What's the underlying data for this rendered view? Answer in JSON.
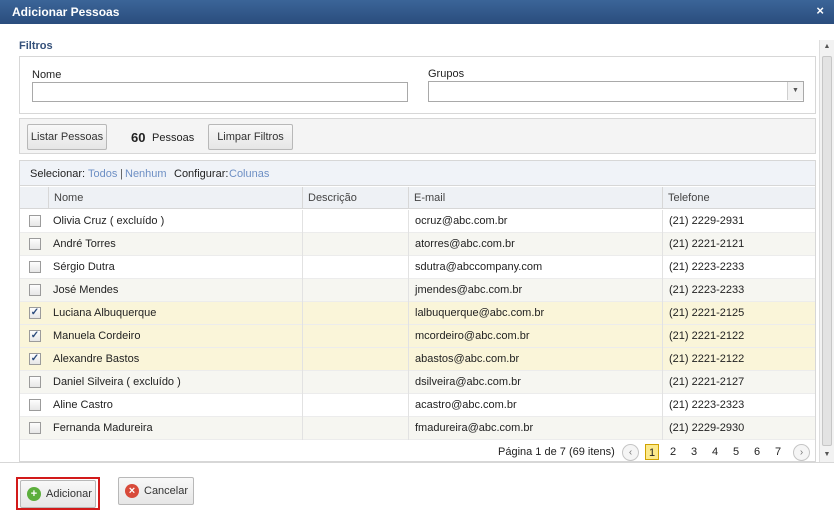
{
  "dialog": {
    "title": "Adicionar Pessoas",
    "close_icon": "×"
  },
  "filters": {
    "section_label": "Filtros",
    "name_label": "Nome",
    "name_value": "",
    "groups_label": "Grupos",
    "groups_value": ""
  },
  "toolbar": {
    "list_button": "Listar Pessoas",
    "count": "60",
    "count_label": "Pessoas",
    "clear_button": "Limpar Filtros"
  },
  "grid": {
    "select_label": "Selecionar:",
    "select_all": "Todos",
    "separator": "|",
    "select_none": "Nenhum",
    "configure_label": "Configurar:",
    "configure_columns": "Colunas",
    "columns": [
      "Nome",
      "Descrição",
      "E-mail",
      "Telefone"
    ],
    "rows": [
      {
        "name": "Olivia Cruz ( excluído )",
        "description": "",
        "email": "ocruz@abc.com.br",
        "phone": "(21) 2229-2931",
        "checked": false
      },
      {
        "name": "André Torres",
        "description": "",
        "email": "atorres@abc.com.br",
        "phone": "(21) 2221-2121",
        "checked": false
      },
      {
        "name": "Sérgio Dutra",
        "description": "",
        "email": "sdutra@abccompany.com",
        "phone": "(21) 2223-2233",
        "checked": false
      },
      {
        "name": "José Mendes",
        "description": "",
        "email": "jmendes@abc.com.br",
        "phone": "(21) 2223-2233",
        "checked": false
      },
      {
        "name": "Luciana Albuquerque",
        "description": "",
        "email": "lalbuquerque@abc.com.br",
        "phone": "(21) 2221-2125",
        "checked": true
      },
      {
        "name": "Manuela Cordeiro",
        "description": "",
        "email": "mcordeiro@abc.com.br",
        "phone": "(21) 2221-2122",
        "checked": true
      },
      {
        "name": "Alexandre Bastos",
        "description": "",
        "email": "abastos@abc.com.br",
        "phone": "(21) 2221-2122",
        "checked": true
      },
      {
        "name": "Daniel Silveira ( excluído )",
        "description": "",
        "email": "dsilveira@abc.com.br",
        "phone": "(21) 2221-2127",
        "checked": false
      },
      {
        "name": "Aline Castro",
        "description": "",
        "email": "acastro@abc.com.br",
        "phone": "(21) 2223-2323",
        "checked": false
      },
      {
        "name": "Fernanda Madureira",
        "description": "",
        "email": "fmadureira@abc.com.br",
        "phone": "(21) 2229-2930",
        "checked": false
      }
    ],
    "check_mark": "✓"
  },
  "pagination": {
    "info": "Página 1 de 7 (69 itens)",
    "pages": [
      "1",
      "2",
      "3",
      "4",
      "5",
      "6",
      "7"
    ],
    "current": "1",
    "prev_icon": "‹",
    "next_icon": "›"
  },
  "footer": {
    "add_button": "Adicionar",
    "cancel_button": "Cancelar",
    "add_icon": "+",
    "cancel_icon": "×"
  },
  "colors": {
    "titlebar": "#2f5688",
    "link": "#6d8fc4",
    "selected_row": "#faf5d9",
    "current_page": "#fce98a",
    "highlight": "#d21a1a",
    "add_icon": "#5cae3c",
    "cancel_icon": "#d84a3a"
  }
}
